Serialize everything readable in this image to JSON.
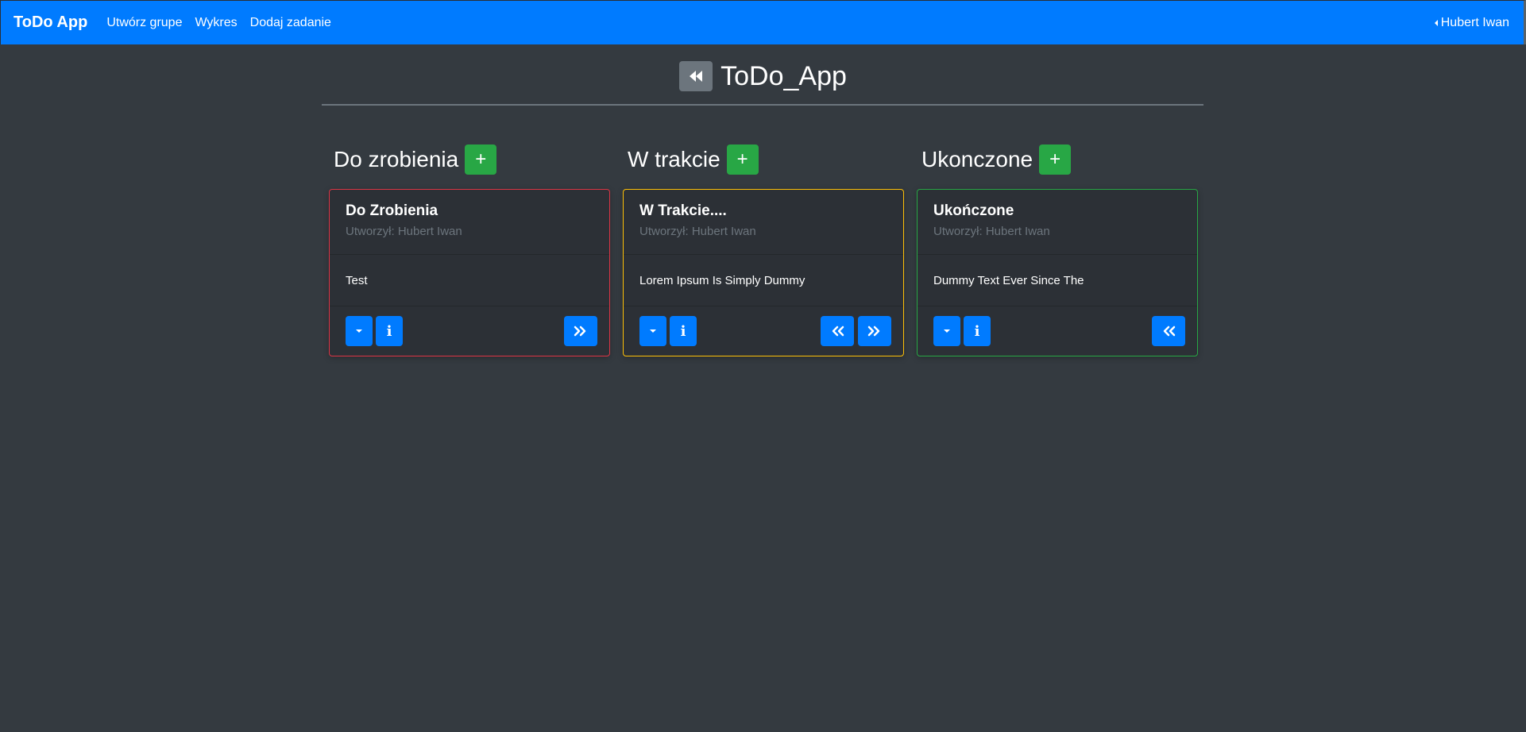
{
  "navbar": {
    "brand": "ToDo App",
    "links": [
      "Utwórz grupe",
      "Wykres",
      "Dodaj zadanie"
    ],
    "user": "Hubert Iwan",
    "color": "#007bff"
  },
  "header": {
    "title": "ToDo_App",
    "back_icon": "rewind-icon"
  },
  "columns": [
    {
      "title": "Do zrobienia",
      "add_label": "+",
      "border_color": "#dc3545",
      "card": {
        "title": "Do Zrobienia",
        "author": "Utworzył: Hubert Iwan",
        "text": "Test",
        "actions": [
          "forward"
        ]
      }
    },
    {
      "title": "W trakcie",
      "add_label": "+",
      "border_color": "#ffc107",
      "card": {
        "title": "W Trakcie....",
        "author": "Utworzył: Hubert Iwan",
        "text": "Lorem Ipsum Is Simply Dummy",
        "actions": [
          "back",
          "forward"
        ]
      }
    },
    {
      "title": "Ukonczone",
      "add_label": "+",
      "border_color": "#28a745",
      "card": {
        "title": "Ukończone",
        "author": "Utworzył: Hubert Iwan",
        "text": "Dummy Text Ever Since The",
        "actions": [
          "back"
        ]
      }
    }
  ],
  "colors": {
    "background": "#343a40",
    "primary": "#007bff",
    "success": "#28a745",
    "secondary": "#6c757d"
  }
}
